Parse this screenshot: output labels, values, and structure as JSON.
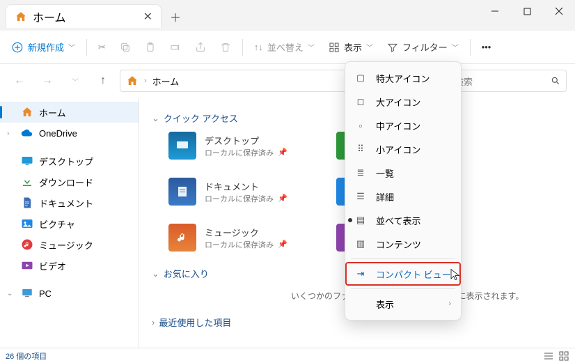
{
  "tab": {
    "title": "ホーム"
  },
  "toolbar": {
    "new": "新規作成",
    "sort": "並べ替え",
    "view": "表示",
    "filter": "フィルター"
  },
  "address": {
    "path": "ホーム"
  },
  "search": {
    "placeholder": "検索"
  },
  "sidebar": {
    "home": "ホーム",
    "onedrive": "OneDrive",
    "desktop": "デスクトップ",
    "downloads": "ダウンロード",
    "documents": "ドキュメント",
    "pictures": "ピクチャ",
    "music": "ミュージック",
    "videos": "ビデオ",
    "pc": "PC"
  },
  "content": {
    "quick_access": "クイック アクセス",
    "favorites": "お気に入り",
    "recent": "最近使用した項目",
    "fav_empty": "いくつかのファイルをピン留めすると、ここに表示されます。",
    "saved_local": "ローカルに保存済み",
    "items": {
      "desktop": "デスクトップ",
      "documents": "ドキュメント",
      "music": "ミュージック"
    }
  },
  "menu": {
    "xl_icons": "特大アイコン",
    "l_icons": "大アイコン",
    "m_icons": "中アイコン",
    "s_icons": "小アイコン",
    "list": "一覧",
    "details": "詳細",
    "tiles": "並べて表示",
    "content": "コンテンツ",
    "compact": "コンパクト ビュー",
    "show": "表示"
  },
  "status": {
    "count": "26 個の項目"
  }
}
